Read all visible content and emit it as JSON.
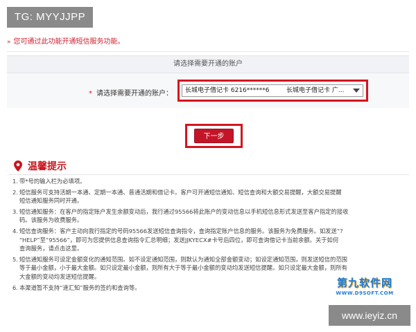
{
  "watermark_top": "TG: MYYJJPP",
  "notice": {
    "arrows": "»",
    "text": "您可通过此功能开通短信服务功能。"
  },
  "panel": {
    "title": "请选择需要开通的账户",
    "account_label": "请选择需要开通的账户：",
    "required_mark": "*",
    "select": {
      "value_left": "长城电子借记卡 6216******6",
      "value_right": "长城电子借记卡 广...",
      "icon": "chevron-down-icon"
    }
  },
  "next_button": "下一步",
  "tips": {
    "title": "温馨提示",
    "items": [
      {
        "num": "1.",
        "lines": [
          "带*号的输入栏为必填项。"
        ]
      },
      {
        "num": "2.",
        "lines": [
          "短信服务可支持活期一本通、定期一本通、普通活期和借记卡。客户可开通短信通知、短信查询和大额交易提醒，大额交易提醒",
          "短信通知服务同时开通。"
        ]
      },
      {
        "num": "3.",
        "lines": [
          "短信通知服务：在客户的指定账户发生余额变动后，我行通过95566将此账户的变动信息以手机短信息形式发送至客户指定的接收",
          "码。该服务为收费服务。"
        ]
      },
      {
        "num": "4.",
        "lines": [
          "短信查询服务：客户主动向我行指定的号码95566发送短信查询指令，查询指定账户信息的服务。该服务为免费服务。如发送“?",
          "“HELP”至“95566”，即可为您提供信息查询指令汇总明细；发送JJKYECX#卡号后四位，即可查询借记卡当前余额。关于如何",
          "查询服务，请点击这里。"
        ]
      },
      {
        "num": "5.",
        "lines": [
          "短信通知服务可设定金额变化的通知范围。如不设定通知范围，则默认为通知全部金额变动；如设定通知范围，则发送短信的范围",
          "等于最小金额，小于最大金额。如只设定最小金额，则所有大于等于最小金额的变动均发送短信提醒。如只设定最大金额，则所有",
          "大金额的变动均发送短信提醒。"
        ]
      },
      {
        "num": "6.",
        "lines": [
          "本渠道暂不支持“速汇知”服务的签约和查询等。"
        ]
      }
    ]
  },
  "logo": {
    "big": "第九软件网",
    "small": "WWW.D9SOFT.COM"
  },
  "watermark_bottom": "www.ieyiz.cn",
  "colors": {
    "accent_red": "#c41428",
    "highlight_red": "#d3151f",
    "logo_blue": "#1c7cd6"
  }
}
